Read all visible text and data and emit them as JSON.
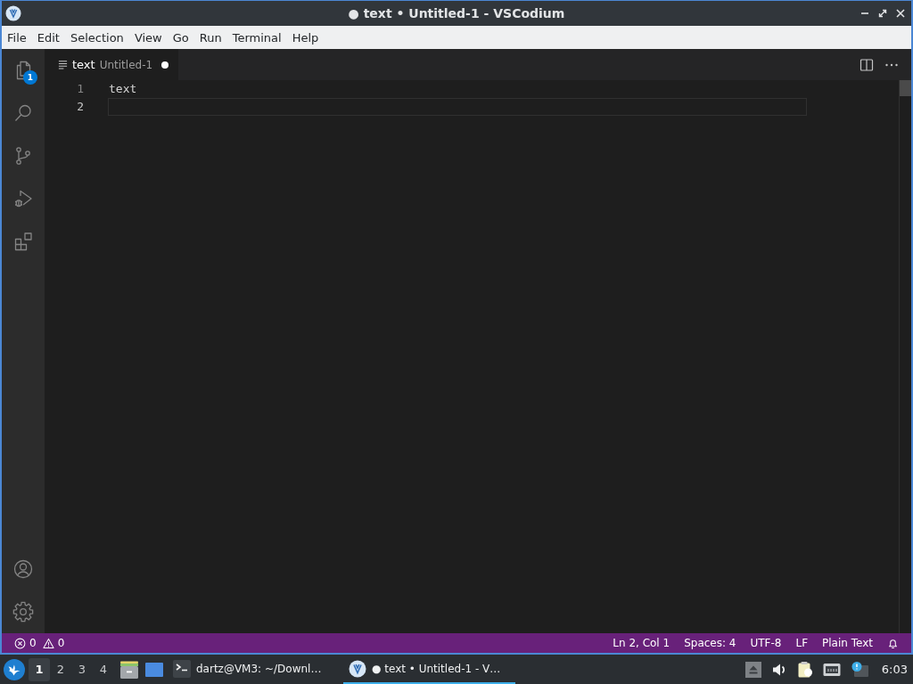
{
  "window": {
    "title": "● text • Untitled-1 - VSCodium"
  },
  "menu": [
    "File",
    "Edit",
    "Selection",
    "View",
    "Go",
    "Run",
    "Terminal",
    "Help"
  ],
  "activity_bar": {
    "explorer_badge": "1"
  },
  "tabs": [
    {
      "label": "text",
      "description": "Untitled-1",
      "selected": true,
      "dirty": true
    }
  ],
  "editor": {
    "lines": [
      {
        "number": "1",
        "text": "text",
        "current": false
      },
      {
        "number": "2",
        "current": true
      }
    ]
  },
  "status_bar": {
    "problems": [
      {
        "kind": "errors",
        "count": "0"
      },
      {
        "kind": "warnings",
        "count": "0"
      }
    ],
    "items": [
      "Ln 2, Col 1",
      "Spaces: 4",
      "UTF-8",
      "LF",
      "Plain Text"
    ]
  },
  "taskbar": {
    "workspaces": [
      {
        "label": "1",
        "selected": true
      },
      {
        "label": "2",
        "selected": false
      },
      {
        "label": "3",
        "selected": false
      },
      {
        "label": "4",
        "selected": false
      }
    ],
    "tasks": [
      {
        "kind": "terminal",
        "label": "dartz@VM3: ~/Downl…",
        "selected": false
      },
      {
        "kind": "editor",
        "label": "● text • Untitled-1 - V…",
        "selected": true
      }
    ],
    "clock": "6:03"
  }
}
